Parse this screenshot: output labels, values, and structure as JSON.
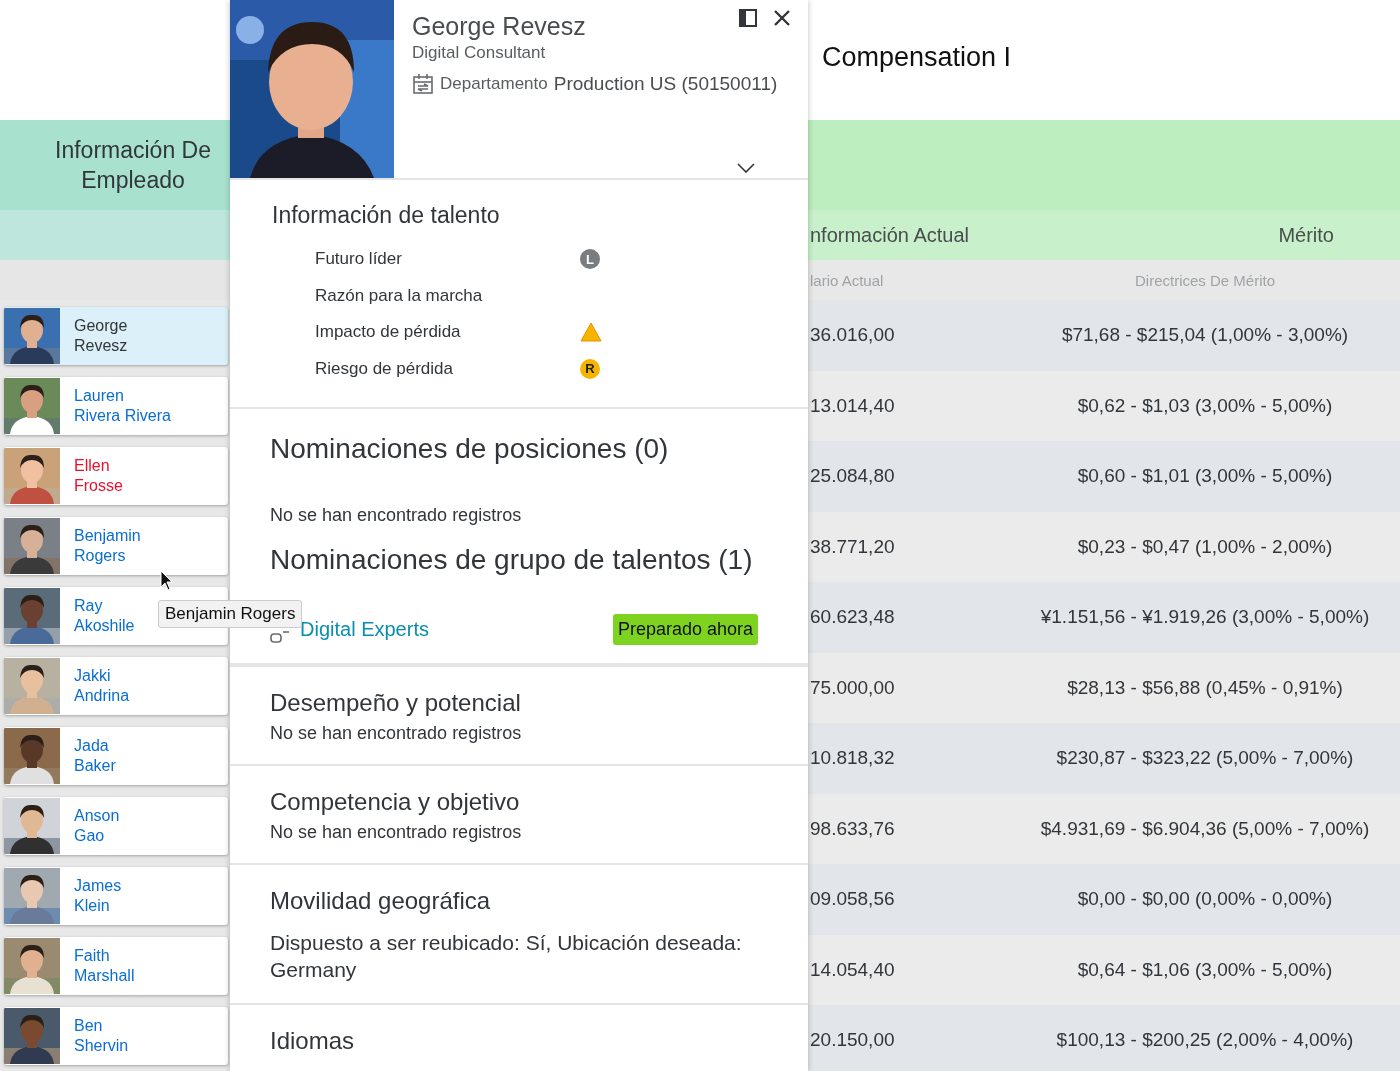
{
  "employee_column": {
    "header": "Información De Empleado",
    "employees": [
      {
        "first": "George",
        "last": "Revesz",
        "selected": true,
        "color": "#32363a"
      },
      {
        "first": "Lauren",
        "last": "Rivera Rivera",
        "selected": false,
        "color": "#0a6ed1"
      },
      {
        "first": "Ellen",
        "last": "Frosse",
        "selected": false,
        "color": "#e8112d"
      },
      {
        "first": "Benjamin",
        "last": "Rogers",
        "selected": false,
        "color": "#0a6ed1"
      },
      {
        "first": "Ray",
        "last": "Akoshile",
        "selected": false,
        "color": "#0a6ed1"
      },
      {
        "first": "Jakki",
        "last": "Andrina",
        "selected": false,
        "color": "#0a6ed1"
      },
      {
        "first": "Jada",
        "last": "Baker",
        "selected": false,
        "color": "#0a6ed1"
      },
      {
        "first": "Anson",
        "last": "Gao",
        "selected": false,
        "color": "#0a6ed1"
      },
      {
        "first": "James",
        "last": "Klein",
        "selected": false,
        "color": "#0a6ed1"
      },
      {
        "first": "Faith",
        "last": "Marshall",
        "selected": false,
        "color": "#0a6ed1"
      },
      {
        "first": "Ben",
        "last": "Shervin",
        "selected": false,
        "color": "#0a6ed1"
      }
    ]
  },
  "tooltip": "Benjamin Rogers",
  "quick_card": {
    "name": "George Revesz",
    "title": "Digital Consultant",
    "department_label": "Departamento",
    "department": "Production US (50150011)",
    "talent": {
      "title": "Información de talento",
      "items": [
        {
          "label": "Futuro líder",
          "kind": "leader",
          "badge": "L"
        },
        {
          "label": "Razón para la marcha",
          "kind": "none"
        },
        {
          "label": "Impacto de pérdida",
          "kind": "warning"
        },
        {
          "label": "Riesgo de pérdida",
          "kind": "risk",
          "badge": "R"
        }
      ]
    },
    "sections": [
      {
        "kind": "large",
        "title": "Nominaciones de posiciones (0)",
        "text": "No se han encontrado registros"
      },
      {
        "kind": "pool",
        "title": "Nominaciones de grupo de talentos (1)",
        "pool": "Digital Experts",
        "tag": "Preparado ahora"
      },
      {
        "kind": "small",
        "title": "Desempeño y potencial",
        "text": "No se han encontrado registros"
      },
      {
        "kind": "small",
        "title": "Competencia y objetivo",
        "text": "No se han encontrado registros"
      },
      {
        "kind": "mobility",
        "title": "Movilidad geográfica",
        "text": "Dispuesto a ser reubicado: Sí, Ubicación deseada: Germany"
      },
      {
        "kind": "small",
        "title": "Idiomas"
      }
    ]
  },
  "compensation": {
    "title": "Compensation I",
    "group_header": "nformación Actual",
    "merit_header": "Mérito",
    "column_1": "lario Actual",
    "column_2": "Directrices De Mérito",
    "rows": [
      {
        "salary": "36.016,00",
        "merit": "$71,68 - $215,04 (1,00% - 3,00%)"
      },
      {
        "salary": "13.014,40",
        "merit": "$0,62 - $1,03 (3,00% - 5,00%)"
      },
      {
        "salary": "25.084,80",
        "merit": "$0,60 - $1,01 (3,00% - 5,00%)"
      },
      {
        "salary": "38.771,20",
        "merit": "$0,23 - $0,47 (1,00% - 2,00%)"
      },
      {
        "salary": "60.623,48",
        "merit": "¥1.151,56 - ¥1.919,26 (3,00% - 5,00%)"
      },
      {
        "salary": "75.000,00",
        "merit": "$28,13 - $56,88 (0,45% - 0,91%)"
      },
      {
        "salary": "10.818,32",
        "merit": "$230,87 - $323,22 (5,00% - 7,00%)"
      },
      {
        "salary": "98.633,76",
        "merit": "$4.931,69 - $6.904,36 (5,00% - 7,00%)"
      },
      {
        "salary": "09.058,56",
        "merit": "$0,00 - $0,00 (0,00% - 0,00%)"
      },
      {
        "salary": "14.054,40",
        "merit": "$0,64 - $1,06 (3,00% - 5,00%)"
      },
      {
        "salary": "20.150,00",
        "merit": "$100,13 - $200,25 (2,00% - 4,00%)"
      }
    ]
  }
}
